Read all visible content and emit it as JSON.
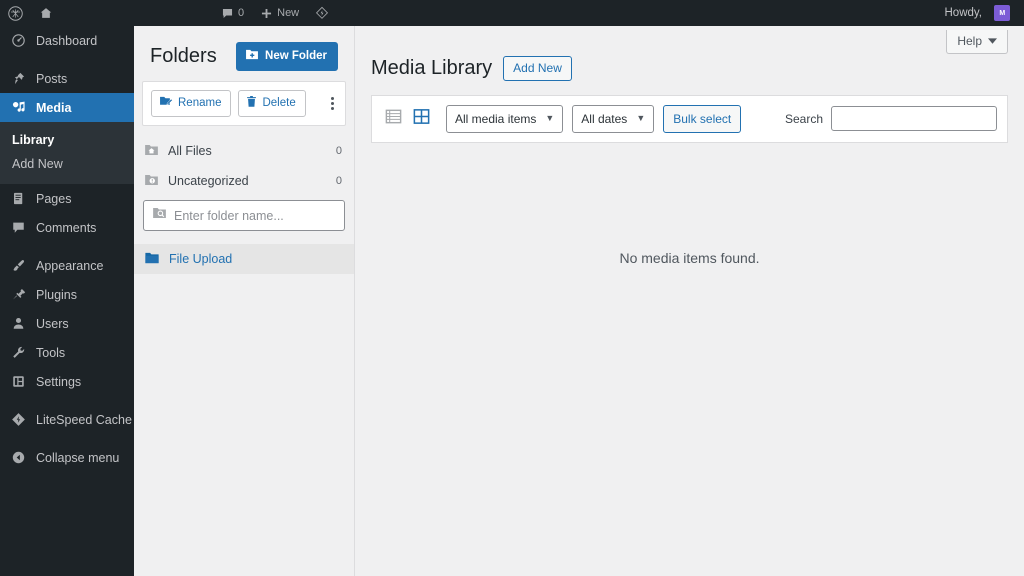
{
  "adminbar": {
    "wp_logo_icon": "wordpress-logo-icon",
    "site_icon": "home-icon",
    "comments_icon": "comment-bubble-icon",
    "comments_count": "0",
    "new_icon": "plus-icon",
    "new_label": "New",
    "litespeed_icon": "litespeed-diamond-icon",
    "howdy": "Howdy,",
    "avatar_initials": "M",
    "avatar_color": "#7c5cd6"
  },
  "sidebar": {
    "accent_color": "#2271b1",
    "background_color": "#1d2327",
    "items": [
      {
        "label": "Dashboard",
        "icon": "dashboard-icon",
        "current": false
      },
      {
        "label": "Posts",
        "icon": "pin-icon",
        "current": false
      },
      {
        "label": "Media",
        "icon": "media-icon",
        "current": true
      },
      {
        "label": "Pages",
        "icon": "page-icon",
        "current": false
      },
      {
        "label": "Comments",
        "icon": "comment-bubble-icon",
        "current": false
      },
      {
        "label": "Appearance",
        "icon": "paintbrush-icon",
        "current": false
      },
      {
        "label": "Plugins",
        "icon": "plug-icon",
        "current": false
      },
      {
        "label": "Users",
        "icon": "user-icon",
        "current": false
      },
      {
        "label": "Tools",
        "icon": "wrench-icon",
        "current": false
      },
      {
        "label": "Settings",
        "icon": "sliders-icon",
        "current": false
      },
      {
        "label": "LiteSpeed Cache",
        "icon": "litespeed-diamond-icon",
        "current": false
      }
    ],
    "submenu": [
      {
        "label": "Library",
        "current": true
      },
      {
        "label": "Add New",
        "current": false
      }
    ],
    "collapse": {
      "label": "Collapse menu",
      "icon": "collapse-arrow-icon"
    }
  },
  "folders": {
    "title": "Folders",
    "new_folder_label": "New Folder",
    "new_folder_icon": "folder-plus-icon",
    "new_folder_color": "#2271b1",
    "rename_label": "Rename",
    "rename_icon": "folder-edit-icon",
    "delete_label": "Delete",
    "delete_icon": "trash-icon",
    "more_icon": "kebab-menu-icon",
    "rows": [
      {
        "label": "All Files",
        "icon": "folder-home-icon",
        "count": "0",
        "selected": false
      },
      {
        "label": "Uncategorized",
        "icon": "folder-alert-icon",
        "count": "0",
        "selected": false
      }
    ],
    "search": {
      "placeholder": "Enter folder name...",
      "value": "",
      "icon": "folder-search-icon"
    },
    "upload_row": {
      "label": "File Upload",
      "icon": "folder-filled-icon",
      "selected": true
    }
  },
  "main": {
    "help_label": "Help",
    "help_icon": "chevron-down-icon",
    "page_title": "Media Library",
    "add_new_label": "Add New",
    "toolbar": {
      "list_view_icon": "list-view-icon",
      "grid_view_icon": "grid-view-icon",
      "media_filter": {
        "value": "All media items",
        "icon": "chevron-down-icon"
      },
      "dates_filter": {
        "value": "All dates",
        "icon": "chevron-down-icon"
      },
      "bulk_select_label": "Bulk select",
      "search_label": "Search",
      "search_value": "",
      "search_placeholder": ""
    },
    "empty_message": "No media items found."
  }
}
